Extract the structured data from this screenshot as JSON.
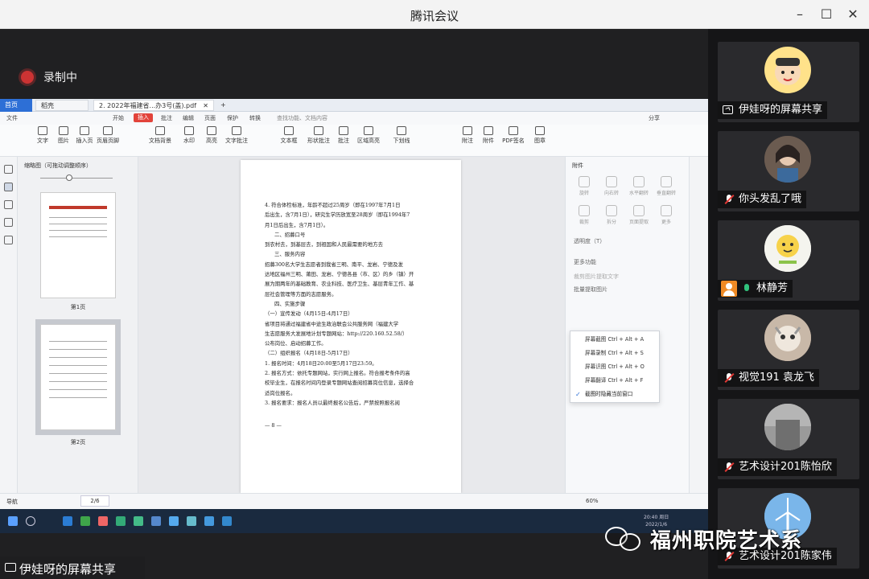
{
  "window": {
    "title": "腾讯会议",
    "controls": [
      "minimize",
      "maximize",
      "close"
    ]
  },
  "recording": {
    "label": "录制中"
  },
  "shared_screen": {
    "tabs": {
      "home": "首页",
      "t2": "稻壳",
      "t3": "2. 2022年福建省...办3号(盖).pdf"
    },
    "menu": [
      "文件",
      "开始",
      "插入",
      "批注",
      "编辑",
      "页面",
      "保护",
      "转换"
    ],
    "menu_active_index": 2,
    "search_hint": "查找功能、文档内容",
    "share_btn": "分享",
    "toolbar": [
      "文字",
      "图片",
      "页眉页脚",
      "水印",
      "文本框",
      "形状批注",
      "区域高亮",
      "下划线",
      "附注",
      "附件",
      "PDF签名",
      "图章",
      "文字批注",
      "批注",
      "高亮",
      "插入页",
      "页眉",
      "文档背景"
    ],
    "thumbs_header": "缩略图（可拖动调整顺序）",
    "thumb_labels": [
      "第1页",
      "第2页"
    ],
    "doc_lines": [
      "4. 符合体检标准，年龄不超过25周岁（即在1997年7月1日",
      "后出生，含7月1日），研究生学历放宽至28周岁（即在1994年7",
      "月1日后出生，含7月1日）。",
      "二、招募口号",
      "到农村去，到基层去，到祖国和人民最需要的地方去",
      "三、服务内容",
      "招募300名大学生志愿者到我省三明、南平、龙岩、宁德及发",
      "达地区福州三明、莆田、龙岩、宁德各县（市、区）的乡（镇）开",
      "展为期两年的基础教育、农业科技、医疗卫生、基层青年工作、基",
      "层社会管理等方面的志愿服务。",
      "四、实施步骤",
      "（一）宣传发动（4月15日-4月17日）",
      "省项目将通过福建省中途生政治联会公共服务网（福建大学",
      "生志愿服务大发展地计划专题网站：http://220.160.52.58/）",
      "公布岗位、启动招募工作。",
      "（二）组织报名（4月18日-5月17日）",
      "1. 报名时间：4月18日20:00至5月17日23:59。",
      "2. 报名方式：依托专题网站，实行网上报名。符合报考条件的高",
      "校毕业生，在报名时间内登录专题网站查阅招募岗位信息，选择合",
      "适岗位报名。",
      "3. 报名要求：报名人员以最终报名公告后，严禁按照报名阅",
      "— 8 —"
    ],
    "right_panel": {
      "header": "附件",
      "icons": [
        "旋转",
        "向右转",
        "水平翻转",
        "垂直翻转",
        "裁剪",
        "拆分",
        "页面提取",
        "更多"
      ],
      "opacity_label": "透明度（T）",
      "more_label": "更多功能",
      "items": [
        "裁剪图片提取文字",
        "批量提取图片"
      ]
    },
    "ctx_menu": [
      {
        "label": "屏幕截图 Ctrl + Alt + A",
        "checked": false
      },
      {
        "label": "屏幕录制 Ctrl + Alt + S",
        "checked": false
      },
      {
        "label": "屏幕识图 Ctrl + Alt + O",
        "checked": false
      },
      {
        "label": "屏幕翻译 Ctrl + Alt + F",
        "checked": false
      },
      {
        "label": "截图时隐藏当前窗口",
        "checked": true
      }
    ],
    "status": {
      "page_label": "2/6",
      "zoom": "60%",
      "nav_label": "导航"
    },
    "taskbar_time": "20:40 周日",
    "taskbar_date": "2022/1/6"
  },
  "caption": {
    "text": "伊娃呀的屏幕共享"
  },
  "participants": [
    {
      "name": "伊娃呀的屏幕共享",
      "icon": "share",
      "avatar_bg": "#ffe28a"
    },
    {
      "name": "你头发乱了哦",
      "icon": "mic-muted",
      "avatar_bg": "#5c5048"
    },
    {
      "name": "林静芳",
      "icon": "mic-on",
      "avatar_bg": "#f7d24a"
    },
    {
      "name": "视觉191 袁龙飞",
      "icon": "mic-muted",
      "avatar_bg": "#b59a86"
    },
    {
      "name": "艺术设计201陈怡欣",
      "icon": "mic-muted",
      "avatar_bg": "#8d8d8d"
    },
    {
      "name": "艺术设计201陈家伟",
      "icon": "mic-muted",
      "avatar_bg": "#6aa9e3"
    }
  ],
  "watermark": {
    "text": "福州职院艺术系"
  }
}
